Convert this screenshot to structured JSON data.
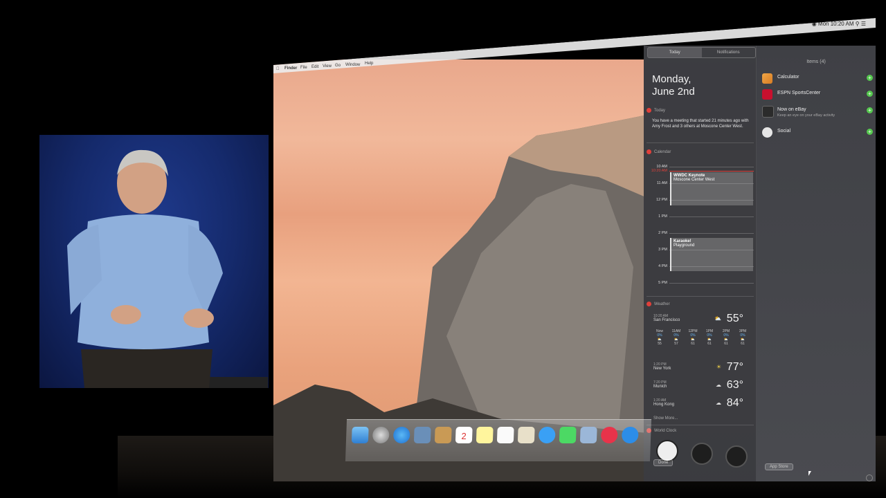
{
  "menubar": {
    "items": [
      "Finder",
      "File",
      "Edit",
      "View",
      "Go",
      "Window",
      "Help"
    ],
    "time": "Mon 10:20 AM"
  },
  "notification_center": {
    "tabs": [
      "Today",
      "Notifications"
    ],
    "date_line1": "Monday,",
    "date_line2": "June 2nd",
    "today_section": {
      "header": "Today",
      "text": "You have a meeting that started 21 minutes ago with Amy Frost and 3 others at Moscone Center West."
    },
    "calendar": {
      "header": "Calendar",
      "hours": [
        "10 AM",
        "11 AM",
        "12 PM",
        "1 PM",
        "2 PM",
        "3 PM",
        "4 PM",
        "5 PM"
      ],
      "now_label": "10:20 AM",
      "events": [
        {
          "title": "WWDC Keynote",
          "location": "Moscone Center West"
        },
        {
          "title": "Karaoke!",
          "location": "Playground"
        }
      ]
    },
    "weather": {
      "header": "Weather",
      "main": {
        "time": "10:20 AM",
        "city": "San Francisco",
        "temp": "55°"
      },
      "forecast": [
        {
          "label": "Now",
          "pct": "0%",
          "temp": "55"
        },
        {
          "label": "11AM",
          "pct": "0%",
          "temp": "57"
        },
        {
          "label": "12PM",
          "pct": "0%",
          "temp": "61"
        },
        {
          "label": "1PM",
          "pct": "0%",
          "temp": "61"
        },
        {
          "label": "2PM",
          "pct": "0%",
          "temp": "61"
        },
        {
          "label": "3PM",
          "pct": "0%",
          "temp": "61"
        }
      ],
      "cities": [
        {
          "time": "1:20 PM",
          "city": "New York",
          "temp": "77°"
        },
        {
          "time": "7:20 PM",
          "city": "Munich",
          "temp": "63°"
        },
        {
          "time": "1:20 AM",
          "city": "Hong Kong",
          "temp": "84°"
        }
      ],
      "show_more": "Show More..."
    },
    "world_clock": {
      "header": "World Clock"
    },
    "done_label": "Done",
    "items_panel": {
      "title": "Items (4)",
      "items": [
        {
          "label": "Calculator",
          "sub": ""
        },
        {
          "label": "ESPN SportsCenter",
          "sub": ""
        },
        {
          "label": "Now on eBay",
          "sub": "Keep an eye on your eBay activity"
        },
        {
          "label": "Social",
          "sub": ""
        }
      ],
      "app_store_label": "App Store"
    }
  },
  "colors": {
    "accent_red": "#e0403a",
    "add_green": "#56c94f",
    "nc_background": "#3c3d42"
  }
}
